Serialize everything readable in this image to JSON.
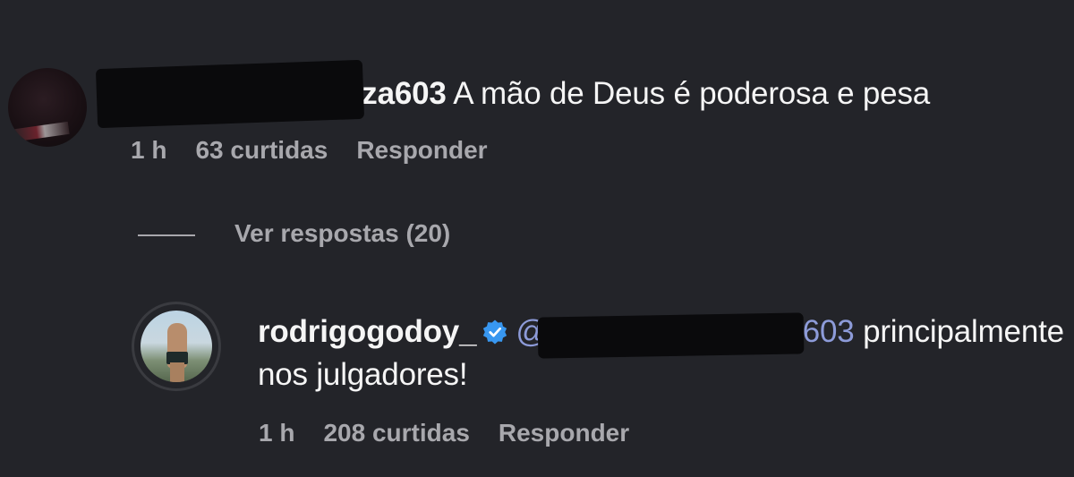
{
  "comments": [
    {
      "username": "c__________ouza603",
      "text": "A mão de Deus é poderosa e pesa",
      "time": "1 h",
      "likes": "63 curtidas",
      "reply_label": "Responder",
      "view_replies": "Ver respostas (20)"
    }
  ],
  "reply": {
    "username": "rodrigogodoy_",
    "verified": true,
    "mention": "@c__________ouza603",
    "text_part1": "principalmente",
    "text_part2": "nos julgadores!",
    "time": "1 h",
    "likes": "208 curtidas",
    "reply_label": "Responder"
  },
  "colors": {
    "background": "#232429",
    "text_primary": "#f5f5f5",
    "text_secondary": "#a8a8ad",
    "mention": "#8d9bd9",
    "verified_badge": "#3897f0"
  },
  "icons": {
    "verified": "verified-badge-icon"
  }
}
